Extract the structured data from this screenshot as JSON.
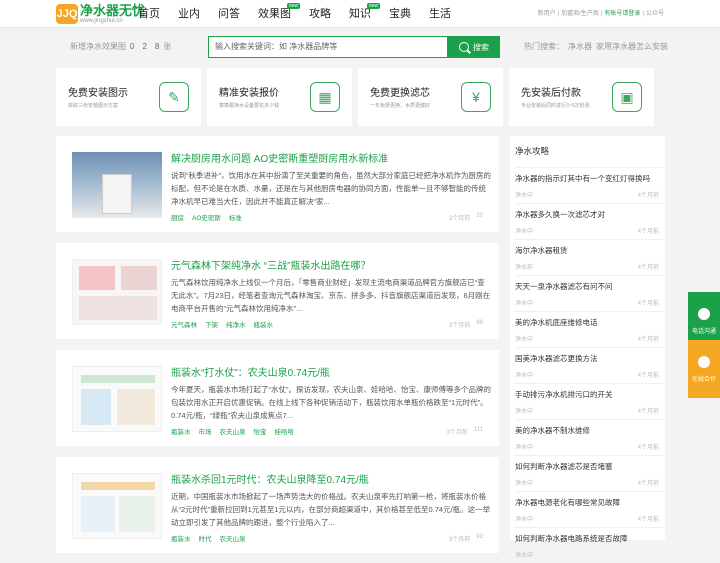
{
  "logo": {
    "mark": "JJQ",
    "title": "净水器无忧",
    "sub": "www.jingshui.cn"
  },
  "nav": [
    {
      "label": "首页",
      "badge": ""
    },
    {
      "label": "业内",
      "badge": ""
    },
    {
      "label": "问答",
      "badge": ""
    },
    {
      "label": "效果图",
      "badge": "new"
    },
    {
      "label": "攻略",
      "badge": ""
    },
    {
      "label": "知识",
      "badge": "new"
    },
    {
      "label": "宝典",
      "badge": ""
    },
    {
      "label": "生活",
      "badge": ""
    }
  ],
  "toplinks": {
    "a": "新用户",
    "b": "加盟商/生产商",
    "c": "有账号请登录",
    "d": "公众号"
  },
  "stat": {
    "prefix": "新增净水效果图",
    "d1": "0",
    "d2": "2",
    "d3": "8",
    "suffix": "张"
  },
  "search": {
    "placeholder": "输入搜索关键词：如 净水器品牌等",
    "button": "搜索"
  },
  "hot": {
    "label": "热门搜索：",
    "k1": "净水器",
    "k2": "家用净水器怎么安装"
  },
  "features": [
    {
      "title": "免费安装图示",
      "sub": "获取三份安装图示方案",
      "icon": "✎"
    },
    {
      "title": "精准安装报价",
      "sub": "算算跟净水设备要花多少钱",
      "icon": "▦"
    },
    {
      "title": "免费更换滤芯",
      "sub": "一年免费更换，水质更健好",
      "icon": "¥"
    },
    {
      "title": "先安装后付款",
      "sub": "专业安装后同时进行3~5次检测",
      "icon": "▣"
    }
  ],
  "articles": [
    {
      "title": "解决厨房用水问题 AO史密斯重塑厨房用水新标准",
      "desc": "说到“秋季进补”，饮用水在其中扮演了至关重要的角色，虽然大部分家庭已经把净水机作为厨房的标配，但不论是在水质、水量，还是在与其他厨房电器的协同方面，性能单一且不够智能的传统净水机早已难当大任，因此并不能真正解决“家...",
      "tags": [
        "厨房",
        "AO史密斯",
        "标准"
      ],
      "time": "3个月前",
      "views": "20"
    },
    {
      "title": "元气森林下架纯净水 “三战”瓶装水出路在哪？",
      "desc": "元气森林饮用纯净水上线仅一个月后，「零售商业财经」发现主流电商渠道品牌官方旗舰店已“查无此水”。7月23日，经笔者查询元气森林淘宝、京东、拼多多、抖音旗舰店渠道后发现，6月刚在电商平台开售的“元气森林饮用纯净水”...",
      "tags": [
        "元气森林",
        "下架",
        "纯净水",
        "瓶装水"
      ],
      "time": "3个月前",
      "views": "86"
    },
    {
      "title": "瓶装水“打水仗”：农夫山泉0.74元/瓶",
      "desc": "今年夏天，瓶装水市场打起了“水仗”。探访发现，农夫山泉、娃哈哈、怡宝、康师傅等多个品牌的包装饮用水正开启优惠促销。在线上线下各种促销活动下，瓶装饮用水单瓶价格跌至“1元时代”。0.74元/瓶，“绿瓶”农夫山泉成焦点7...",
      "tags": [
        "瓶装水",
        "市场",
        "农夫山泉",
        "怡宝",
        "娃哈哈"
      ],
      "time": "3个月前",
      "views": "111"
    },
    {
      "title": "瓶装水杀回1元时代：农夫山泉降至0.74元/瓶",
      "desc": "近期，中国瓶装水市场掀起了一场声势浩大的价格战。农夫山泉率先打响第一枪，将瓶装水价格从“2元时代”重新拉回到1元甚至1元以内，在部分商超渠道中，其价格甚至低至0.74元/瓶。这一举动立即引发了其他品牌的跟进，整个行业陷入了...",
      "tags": [
        "瓶装水",
        "时代",
        "农夫山泉"
      ],
      "time": "3个月前",
      "views": "92"
    }
  ],
  "sidebar": {
    "title": "净水攻略",
    "items": [
      {
        "title": "净水器的指示灯其中有一个变红灯得换吗",
        "cat": "净水中",
        "date": "4个月前"
      },
      {
        "title": "净水器多久换一次滤芯才对",
        "cat": "净水中",
        "date": "4个月前"
      },
      {
        "title": "海尔净水器租赁",
        "cat": "净水前",
        "date": "4个月前"
      },
      {
        "title": "天天一泉净水器滤芯有问不问",
        "cat": "净水中",
        "date": "4个月前"
      },
      {
        "title": "美的净水机底座维修电话",
        "cat": "净水中",
        "date": "4个月前"
      },
      {
        "title": "国美净水器滤芯更换方法",
        "cat": "净水中",
        "date": "4个月前"
      },
      {
        "title": "手动排污净水机排污口的开关",
        "cat": "净水中",
        "date": "4个月前"
      },
      {
        "title": "美的净水器不制水维修",
        "cat": "净水中",
        "date": "4个月前"
      },
      {
        "title": "如何判断净水器滤芯是否堵塞",
        "cat": "净水中",
        "date": "4个月前"
      },
      {
        "title": "净水器电源老化有哪些常见故障",
        "cat": "净水中",
        "date": "4个月前"
      },
      {
        "title": "如何判断净水器电路系统是否故障",
        "cat": "净水中",
        "date": ""
      }
    ]
  },
  "floats": {
    "phone": "电话沟通",
    "coop": "在线合作"
  },
  "colors": {
    "accent": "#1aa14a",
    "orange": "#f5a623"
  }
}
